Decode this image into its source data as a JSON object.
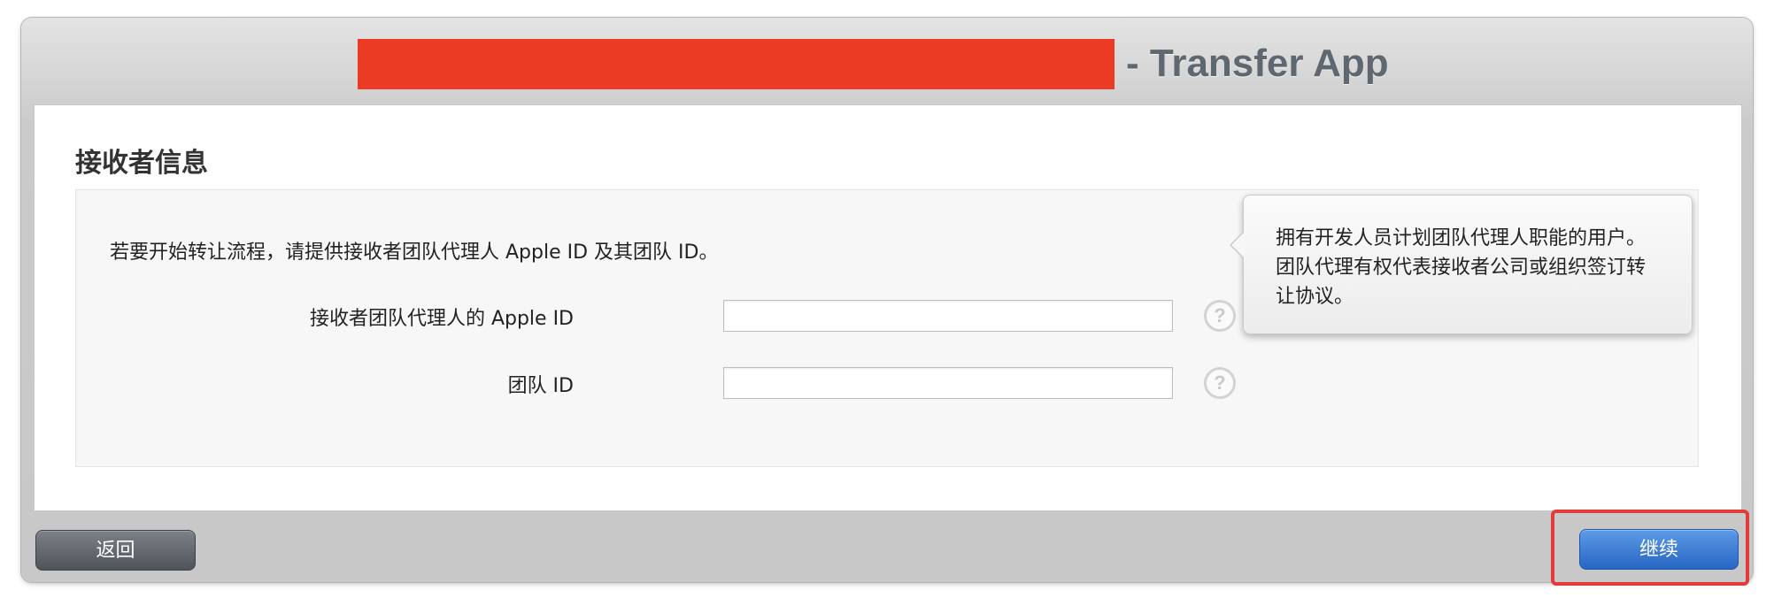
{
  "window": {
    "title_suffix": "- Transfer App",
    "redaction_color": "#ec3b24"
  },
  "section": {
    "title": "接收者信息"
  },
  "form": {
    "intro": "若要开始转让流程，请提供接收者团队代理人 Apple ID 及其团队 ID。",
    "apple_id_label": "接收者团队代理人的 Apple ID",
    "apple_id_value": "",
    "team_id_label": "团队 ID",
    "team_id_value": "",
    "help_icon_glyph": "?"
  },
  "tooltip": {
    "text": "拥有开发人员计划团队代理人职能的用户。团队代理有权代表接收者公司或组织签订转让协议。"
  },
  "buttons": {
    "back_label": "返回",
    "continue_label": "继续"
  },
  "colors": {
    "continue_button": "#2f6fcf",
    "back_button": "#5a5e65",
    "highlight_outline": "#e23b3b"
  }
}
